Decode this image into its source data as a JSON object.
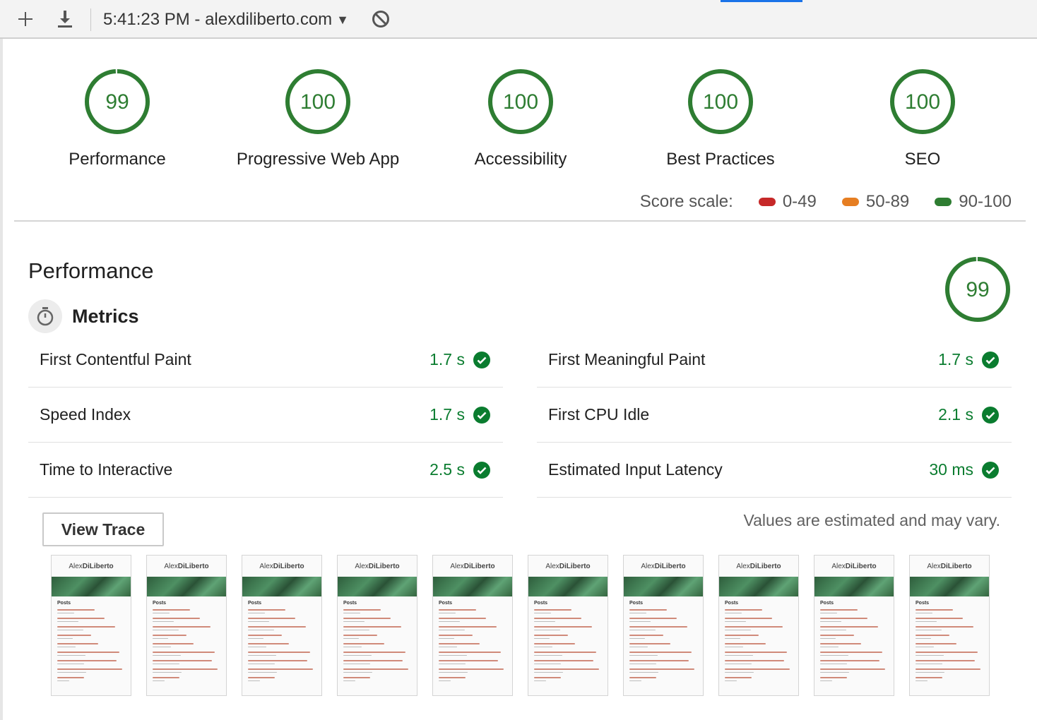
{
  "toolbar": {
    "report_label": "5:41:23 PM - alexdiliberto.com",
    "add_icon": "plus-icon",
    "download_icon": "download-icon",
    "clear_icon": "block-icon"
  },
  "categories": [
    {
      "score": "99",
      "label": "Performance"
    },
    {
      "score": "100",
      "label": "Progressive Web App"
    },
    {
      "score": "100",
      "label": "Accessibility"
    },
    {
      "score": "100",
      "label": "Best Practices"
    },
    {
      "score": "100",
      "label": "SEO"
    }
  ],
  "score_scale": {
    "title": "Score scale:",
    "ranges": [
      {
        "label": "0-49",
        "color": "#c62828"
      },
      {
        "label": "50-89",
        "color": "#e67e22"
      },
      {
        "label": "90-100",
        "color": "#2e7d32"
      }
    ]
  },
  "performance": {
    "title": "Performance",
    "score": "99",
    "metrics_title": "Metrics",
    "metrics": [
      {
        "name": "First Contentful Paint",
        "value": "1.7 s"
      },
      {
        "name": "First Meaningful Paint",
        "value": "1.7 s"
      },
      {
        "name": "Speed Index",
        "value": "1.7 s"
      },
      {
        "name": "First CPU Idle",
        "value": "2.1 s"
      },
      {
        "name": "Time to Interactive",
        "value": "2.5 s"
      },
      {
        "name": "Estimated Input Latency",
        "value": "30 ms"
      }
    ],
    "view_trace_label": "View Trace",
    "estimate_note": "Values are estimated and may vary."
  },
  "filmstrip": {
    "brand_light": "Alex",
    "brand_bold": "DiLiberto",
    "posts_label": "Posts",
    "frame_count": 10
  },
  "colors": {
    "pass": "#0a7c2f",
    "gauge": "#2e7d32",
    "accent": "#1a73e8"
  }
}
